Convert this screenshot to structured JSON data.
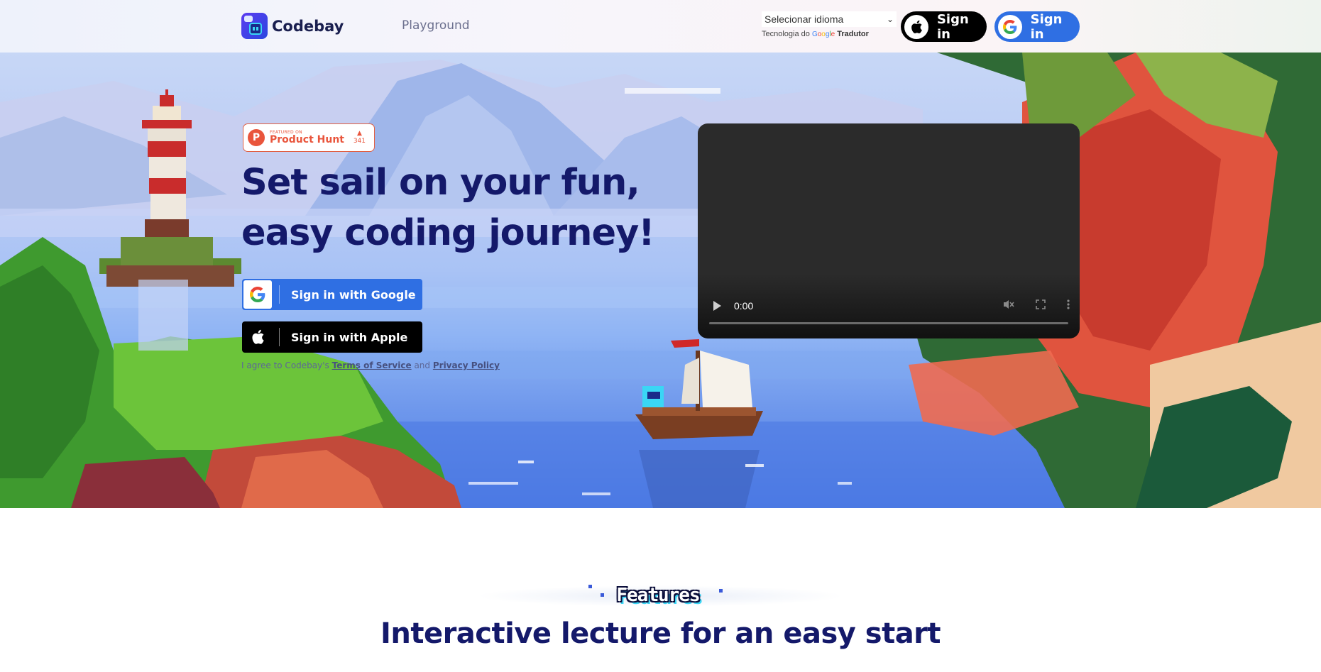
{
  "header": {
    "brand": "Codebay",
    "nav_playground": "Playground",
    "language_select": "Selecionar idioma",
    "powered_prefix": "Tecnologia do",
    "powered_google": "Google",
    "powered_suffix": "Tradutor",
    "apple_signin": "Sign in",
    "google_signin": "Sign in"
  },
  "hero": {
    "badge_small": "FEATURED ON",
    "badge_big": "Product Hunt",
    "badge_votes": "341",
    "title_line1": "Set sail on your fun,",
    "title_line2": "easy coding journey!",
    "google_button": "Sign in with Google",
    "apple_button": "Sign in with Apple",
    "agree_prefix": "I agree to Codebay's",
    "terms": "Terms of Service",
    "agree_and": "and",
    "privacy": "Privacy Policy",
    "video_time": "0:00"
  },
  "features": {
    "tag": "Features",
    "heading": "Interactive lecture for an easy start"
  },
  "colors": {
    "brand_navy": "#14196a",
    "google_blue": "#2f6fe3",
    "apple_black": "#000000",
    "product_hunt": "#e9553c"
  }
}
